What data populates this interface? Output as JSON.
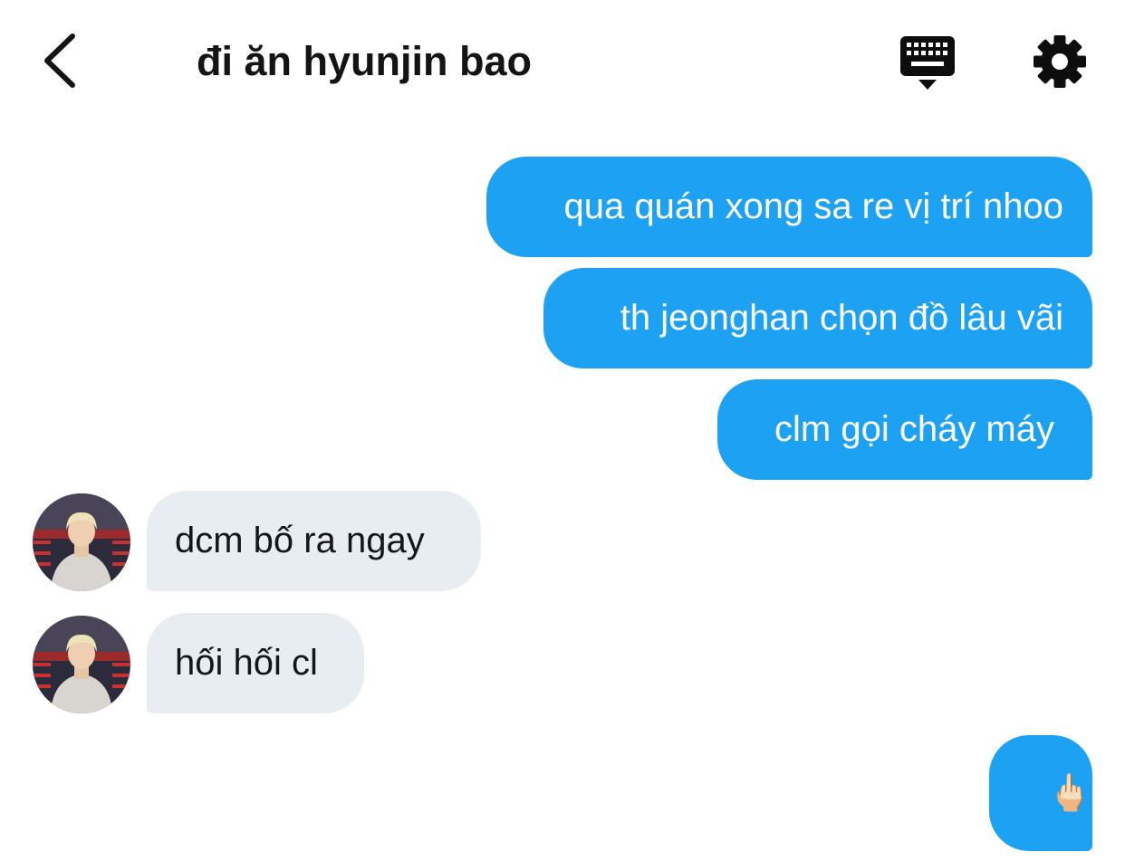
{
  "header": {
    "title": "đi ăn hyunjin bao",
    "back_icon": "chevron-left-icon",
    "keyboard_icon": "keyboard-icon",
    "settings_icon": "gear-icon"
  },
  "colors": {
    "outgoing_bubble": "#1da1f2",
    "incoming_bubble": "#e8edf1",
    "text_dark": "#14171a"
  },
  "messages": [
    {
      "direction": "outgoing",
      "text": "qua quán xong sa re vị trí nhoo"
    },
    {
      "direction": "outgoing",
      "text": "th jeonghan chọn đồ lâu vãi"
    },
    {
      "direction": "outgoing",
      "text": "clm gọi cháy máy"
    },
    {
      "direction": "incoming",
      "text": "dcm bố ra ngay"
    },
    {
      "direction": "incoming",
      "text": "hối hối cl"
    },
    {
      "direction": "outgoing",
      "text": "🖕🏻",
      "icon": "middle-finger-emoji"
    }
  ]
}
